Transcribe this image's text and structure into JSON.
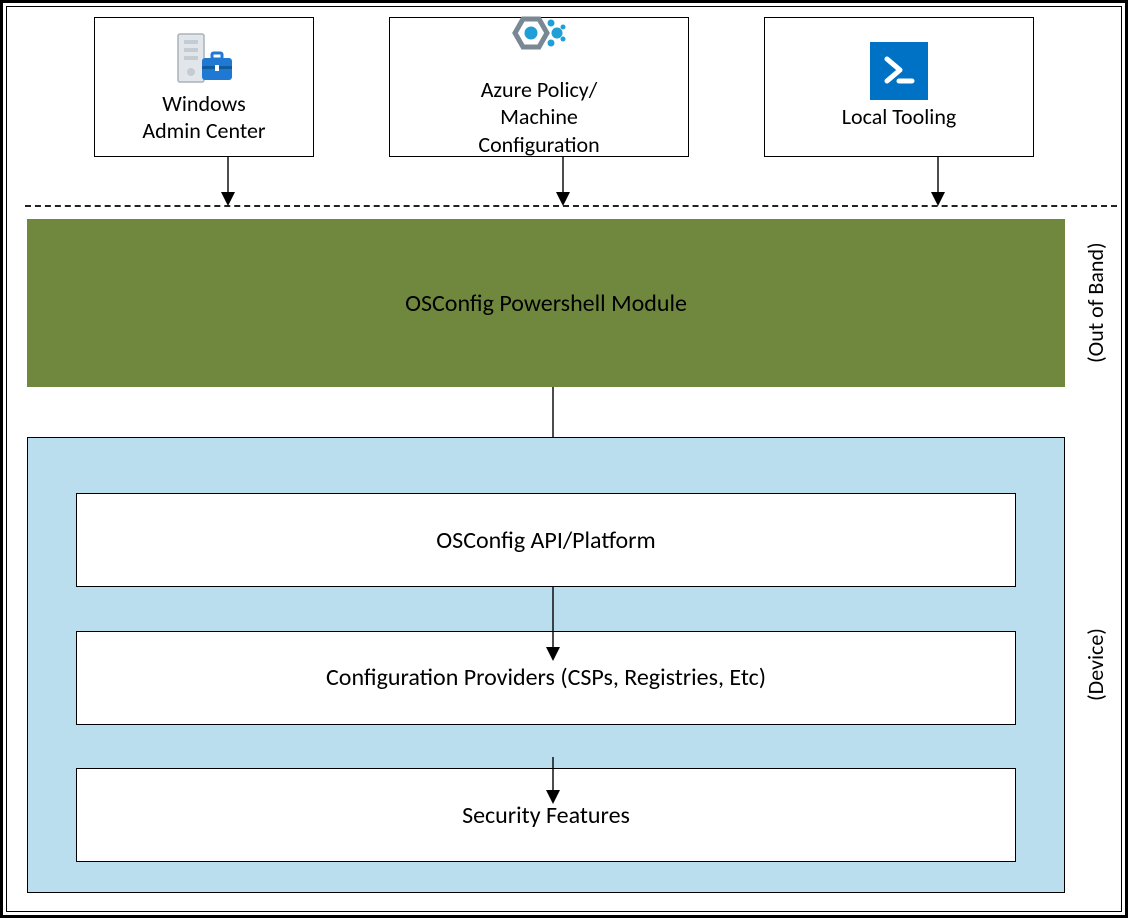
{
  "top": {
    "wac": {
      "line1": "Windows",
      "line2": "Admin Center",
      "icon": "server-briefcase-icon"
    },
    "azure": {
      "line1": "Azure Policy/",
      "line2": "Machine",
      "line3": "Configuration",
      "icon": "azure-policy-icon"
    },
    "local": {
      "line1": "Local Tooling",
      "icon": "powershell-icon"
    }
  },
  "green": {
    "label": "OSConfig Powershell Module"
  },
  "blue": {
    "bar1": "OSConfig API/Platform",
    "bar2": "Configuration Providers (CSPs, Registries, Etc)",
    "bar3": "Security Features"
  },
  "side": {
    "out_of_band": "(Out of Band)",
    "device": "(Device)"
  },
  "colors": {
    "green": "#70883d",
    "blue": "#bbdeee",
    "psblue": "#0072c6"
  }
}
